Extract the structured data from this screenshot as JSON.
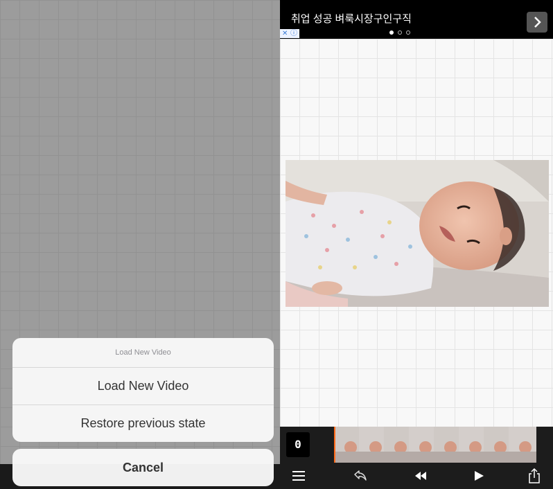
{
  "left_panel": {
    "action_sheet": {
      "title": "Load New Video",
      "items": [
        {
          "label": "Load New Video"
        },
        {
          "label": "Restore previous state"
        }
      ]
    },
    "cancel_label": "Cancel"
  },
  "right_panel": {
    "ad": {
      "title": "취업 성공 벼룩시장구인구직",
      "close_glyph": "✕",
      "info_glyph": "ⓘ",
      "page_count": 3,
      "active_page": 1
    },
    "frame_counter": "0",
    "toolbar": {
      "icons": [
        "menu-icon",
        "undo-icon",
        "rewind-icon",
        "play-icon",
        "share-icon"
      ]
    }
  },
  "colors": {
    "playhead": "#ff6a1a",
    "toolbar_bg": "#1c1c1c",
    "ad_bg": "#000000"
  }
}
